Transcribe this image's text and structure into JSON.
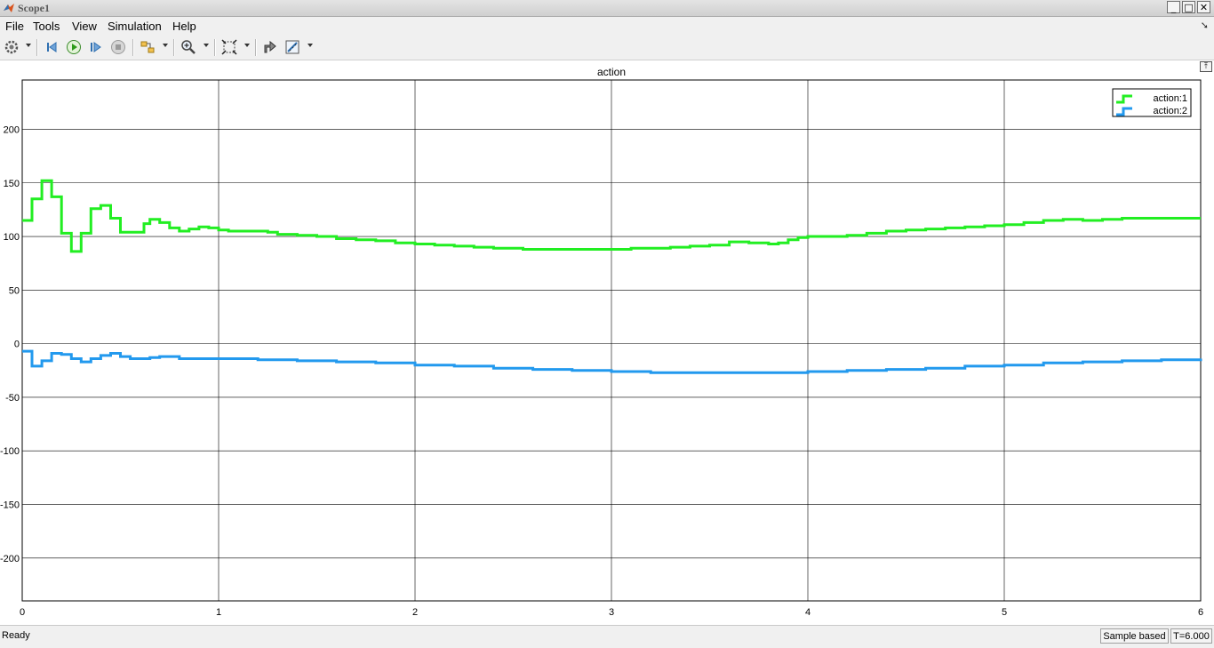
{
  "window": {
    "title": "Scope1"
  },
  "menu": {
    "items": [
      "File",
      "Tools",
      "View",
      "Simulation",
      "Help"
    ]
  },
  "toolbar": {
    "buttons": [
      "configuration-properties-icon",
      "step-back-icon",
      "run-icon",
      "step-forward-icon",
      "stop-icon",
      "highlight-simulink-block-icon",
      "zoom-in-icon",
      "autoscale-icon",
      "restore-view-icon",
      "measurements-icon"
    ]
  },
  "status": {
    "ready": "Ready",
    "mode": "Sample based",
    "time": "T=6.000"
  },
  "chart_data": {
    "type": "line",
    "title": "action",
    "xlabel": "",
    "ylabel": "",
    "xlim": [
      0,
      6
    ],
    "ylim": [
      -240,
      246
    ],
    "x_ticks": [
      "0",
      "1",
      "2",
      "3",
      "4",
      "5",
      "6"
    ],
    "y_ticks": [
      "-200",
      "-150",
      "-100",
      "-50",
      "0",
      "50",
      "100",
      "150",
      "200"
    ],
    "grid": true,
    "legend_position": "top-right",
    "series": [
      {
        "name": "action:1",
        "color": "#22ee22",
        "step": true,
        "points": [
          [
            0,
            115
          ],
          [
            0.05,
            135
          ],
          [
            0.1,
            152
          ],
          [
            0.15,
            137
          ],
          [
            0.2,
            103
          ],
          [
            0.25,
            86
          ],
          [
            0.3,
            103
          ],
          [
            0.35,
            126
          ],
          [
            0.4,
            129
          ],
          [
            0.45,
            117
          ],
          [
            0.5,
            104
          ],
          [
            0.6,
            104
          ],
          [
            0.62,
            112
          ],
          [
            0.65,
            116
          ],
          [
            0.7,
            113
          ],
          [
            0.75,
            108
          ],
          [
            0.8,
            105
          ],
          [
            0.85,
            107
          ],
          [
            0.9,
            109
          ],
          [
            0.95,
            108
          ],
          [
            1.0,
            106
          ],
          [
            1.05,
            105
          ],
          [
            1.2,
            105
          ],
          [
            1.25,
            104
          ],
          [
            1.3,
            102
          ],
          [
            1.4,
            101
          ],
          [
            1.5,
            100
          ],
          [
            1.6,
            98
          ],
          [
            1.7,
            97
          ],
          [
            1.8,
            96
          ],
          [
            1.9,
            94
          ],
          [
            2.0,
            93
          ],
          [
            2.1,
            92
          ],
          [
            2.2,
            91
          ],
          [
            2.3,
            90
          ],
          [
            2.4,
            89
          ],
          [
            2.5,
            89
          ],
          [
            2.55,
            88
          ],
          [
            3.0,
            88
          ],
          [
            3.1,
            89
          ],
          [
            3.2,
            89
          ],
          [
            3.3,
            90
          ],
          [
            3.4,
            91
          ],
          [
            3.5,
            92
          ],
          [
            3.6,
            95
          ],
          [
            3.7,
            94
          ],
          [
            3.8,
            93
          ],
          [
            3.85,
            94
          ],
          [
            3.9,
            97
          ],
          [
            3.95,
            99
          ],
          [
            4.0,
            100
          ],
          [
            4.1,
            100
          ],
          [
            4.2,
            101
          ],
          [
            4.3,
            103
          ],
          [
            4.4,
            105
          ],
          [
            4.5,
            106
          ],
          [
            4.6,
            107
          ],
          [
            4.7,
            108
          ],
          [
            4.8,
            109
          ],
          [
            4.9,
            110
          ],
          [
            5.0,
            111
          ],
          [
            5.1,
            113
          ],
          [
            5.2,
            115
          ],
          [
            5.3,
            116
          ],
          [
            5.4,
            115
          ],
          [
            5.5,
            116
          ],
          [
            5.6,
            117
          ],
          [
            6.0,
            117
          ]
        ]
      },
      {
        "name": "action:2",
        "color": "#2299ee",
        "step": true,
        "points": [
          [
            0,
            -7
          ],
          [
            0.05,
            -21
          ],
          [
            0.1,
            -16
          ],
          [
            0.15,
            -9
          ],
          [
            0.2,
            -10
          ],
          [
            0.25,
            -14
          ],
          [
            0.3,
            -17
          ],
          [
            0.35,
            -14
          ],
          [
            0.4,
            -11
          ],
          [
            0.45,
            -9
          ],
          [
            0.5,
            -12
          ],
          [
            0.55,
            -14
          ],
          [
            0.65,
            -13
          ],
          [
            0.7,
            -12
          ],
          [
            0.8,
            -14
          ],
          [
            1.0,
            -14
          ],
          [
            1.2,
            -15
          ],
          [
            1.4,
            -16
          ],
          [
            1.6,
            -17
          ],
          [
            1.8,
            -18
          ],
          [
            2.0,
            -20
          ],
          [
            2.2,
            -21
          ],
          [
            2.4,
            -23
          ],
          [
            2.6,
            -24
          ],
          [
            2.8,
            -25
          ],
          [
            3.0,
            -26
          ],
          [
            3.2,
            -27
          ],
          [
            3.5,
            -27
          ],
          [
            3.8,
            -27
          ],
          [
            4.0,
            -26
          ],
          [
            4.2,
            -25
          ],
          [
            4.4,
            -24
          ],
          [
            4.6,
            -23
          ],
          [
            4.8,
            -21
          ],
          [
            5.0,
            -20
          ],
          [
            5.2,
            -18
          ],
          [
            5.4,
            -17
          ],
          [
            5.6,
            -16
          ],
          [
            5.8,
            -15
          ],
          [
            6.0,
            -14
          ]
        ]
      }
    ]
  }
}
